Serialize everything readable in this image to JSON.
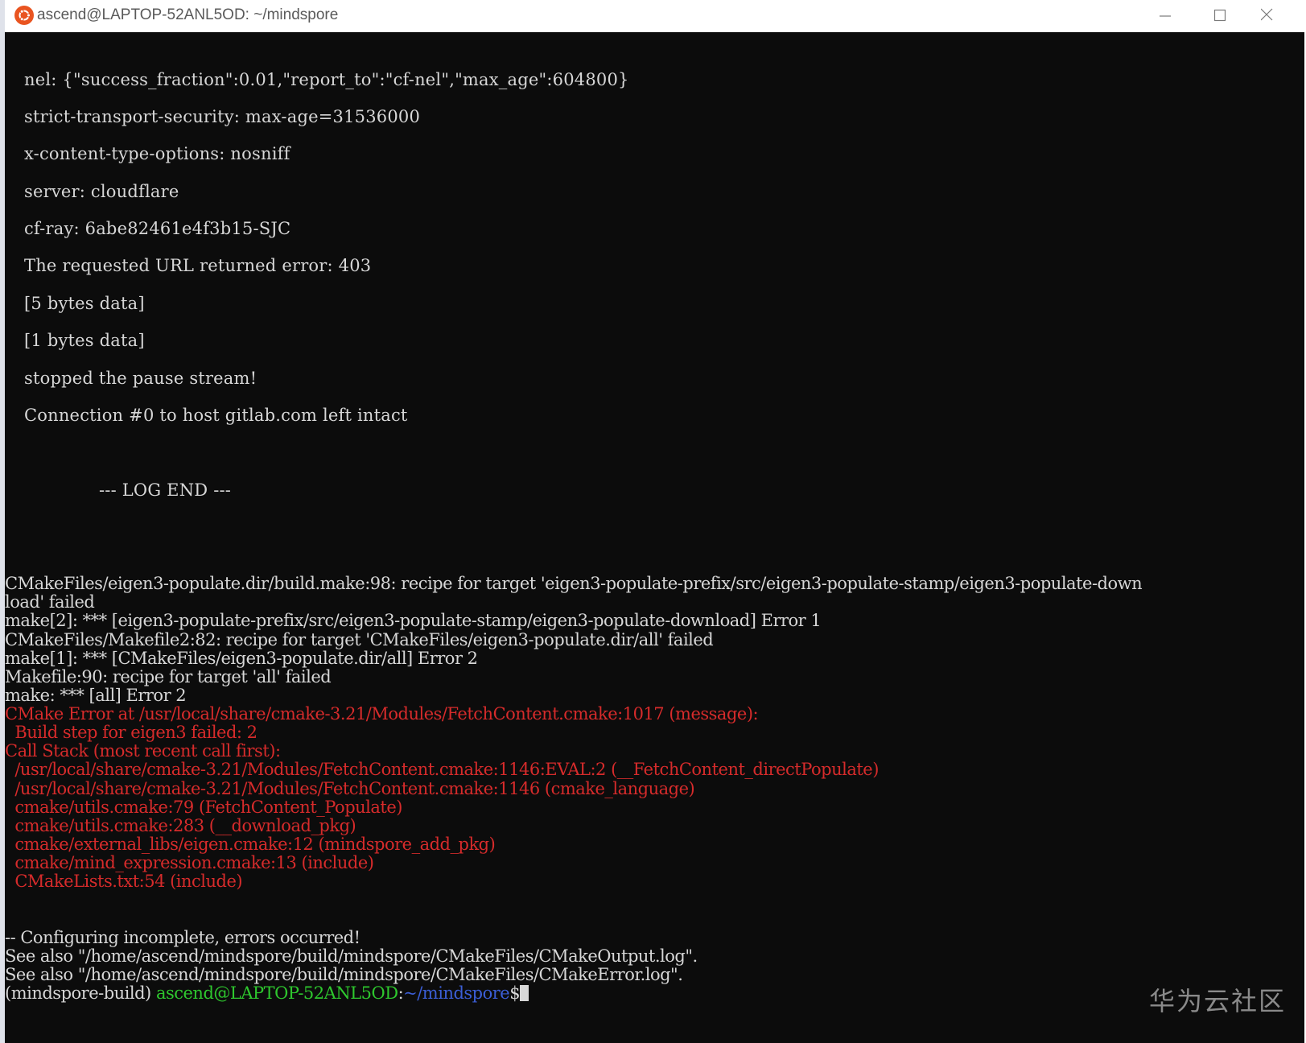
{
  "window": {
    "title": "ascend@LAPTOP-52ANL5OD: ~/mindspore"
  },
  "terminal": {
    "log_lines": [
      "nel: {\"success_fraction\":0.01,\"report_to\":\"cf-nel\",\"max_age\":604800}",
      "strict-transport-security: max-age=31536000",
      "x-content-type-options: nosniff",
      "server: cloudflare",
      "cf-ray: 6abe82461e4f3b15-SJC",
      "The requested URL returned error: 403",
      "[5 bytes data]",
      "[1 bytes data]",
      "stopped the pause stream!",
      "Connection #0 to host gitlab.com left intact"
    ],
    "log_end": "--- LOG END ---",
    "make_lines": [
      "CMakeFiles/eigen3-populate.dir/build.make:98: recipe for target 'eigen3-populate-prefix/src/eigen3-populate-stamp/eigen3-populate-down",
      "load' failed",
      "make[2]: *** [eigen3-populate-prefix/src/eigen3-populate-stamp/eigen3-populate-download] Error 1",
      "CMakeFiles/Makefile2:82: recipe for target 'CMakeFiles/eigen3-populate.dir/all' failed",
      "make[1]: *** [CMakeFiles/eigen3-populate.dir/all] Error 2",
      "Makefile:90: recipe for target 'all' failed",
      "make: *** [all] Error 2"
    ],
    "error_lines": [
      "CMake Error at /usr/local/share/cmake-3.21/Modules/FetchContent.cmake:1017 (message):",
      "  Build step for eigen3 failed: 2",
      "Call Stack (most recent call first):",
      "  /usr/local/share/cmake-3.21/Modules/FetchContent.cmake:1146:EVAL:2 (__FetchContent_directPopulate)",
      "  /usr/local/share/cmake-3.21/Modules/FetchContent.cmake:1146 (cmake_language)",
      "  cmake/utils.cmake:79 (FetchContent_Populate)",
      "  cmake/utils.cmake:283 (__download_pkg)",
      "  cmake/external_libs/eigen.cmake:12 (mindspore_add_pkg)",
      "  cmake/mind_expression.cmake:13 (include)",
      "  CMakeLists.txt:54 (include)"
    ],
    "footer_lines": [
      "-- Configuring incomplete, errors occurred!",
      "See also \"/home/ascend/mindspore/build/mindspore/CMakeFiles/CMakeOutput.log\".",
      "See also \"/home/ascend/mindspore/build/mindspore/CMakeFiles/CMakeError.log\"."
    ],
    "prompt": {
      "env": "(mindspore-build) ",
      "user_host": "ascend@LAPTOP-52ANL5OD",
      "separator": ":",
      "path": "~/mindspore",
      "symbol": "$"
    }
  },
  "watermark": "华为云社区",
  "colors": {
    "terminal_bg": "#0c0c0c",
    "text": "#d7d7d7",
    "error": "#d62b2b",
    "prompt_user": "#2ec72e",
    "prompt_path": "#3b5ed6",
    "app_icon": "#e95420"
  },
  "icons": {
    "app": "ubuntu-icon",
    "minimize": "minimize-icon",
    "maximize": "maximize-icon",
    "close": "close-icon"
  }
}
